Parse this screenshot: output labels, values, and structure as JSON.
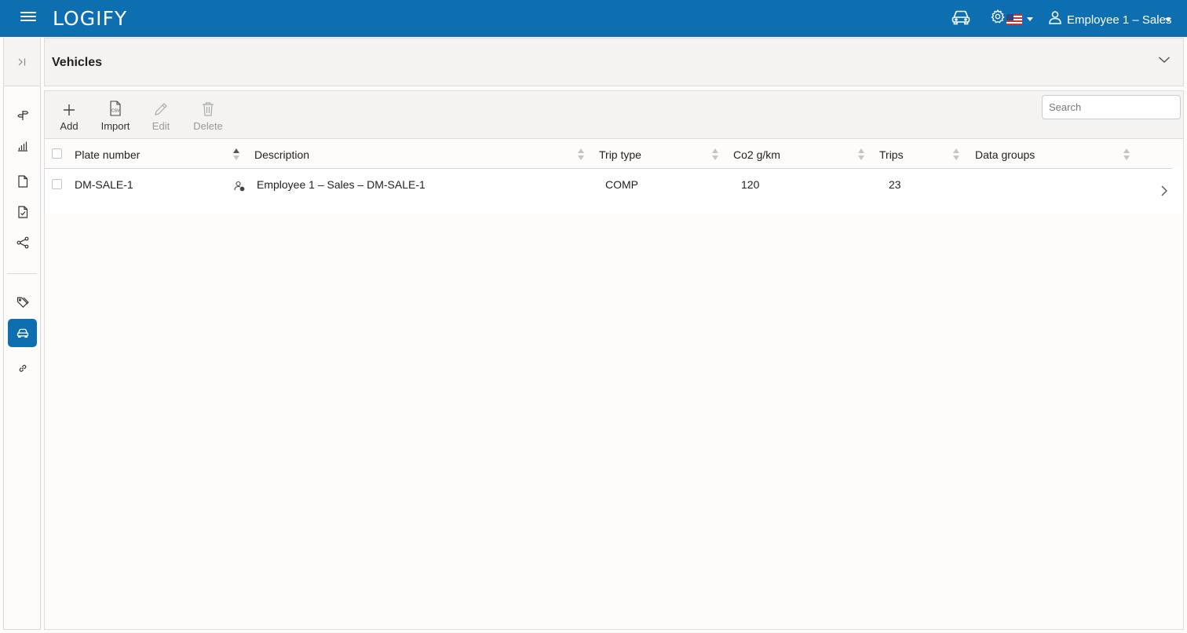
{
  "app": {
    "logo": "LOGIFY",
    "user_name": "Employee 1 – Sales"
  },
  "header": {
    "title": "Vehicles"
  },
  "toolbar": {
    "add": "Add",
    "import": "Import",
    "import_badge": "CSV",
    "edit": "Edit",
    "delete": "Delete",
    "search_placeholder": "Search"
  },
  "table": {
    "columns": [
      "Plate number",
      "Description",
      "Trip type",
      "Co2 g/km",
      "Trips",
      "Data groups"
    ],
    "sorted_column": "Plate number",
    "sort_direction": "ascending",
    "rows": [
      {
        "plate": "DM-SALE-1",
        "description": "Employee 1 – Sales – DM-SALE-1",
        "trip_type": "COMP",
        "co2": "120",
        "trips": "23",
        "data_groups": ""
      }
    ]
  },
  "sidebar": {
    "active_item": "vehicles",
    "items": [
      "trips",
      "reports",
      "documents",
      "approvals",
      "share",
      "tags",
      "vehicles",
      "links"
    ]
  },
  "colors": {
    "brand": "#0e6fb0",
    "background": "#fdfcfb",
    "panel": "#f4f3f1"
  }
}
